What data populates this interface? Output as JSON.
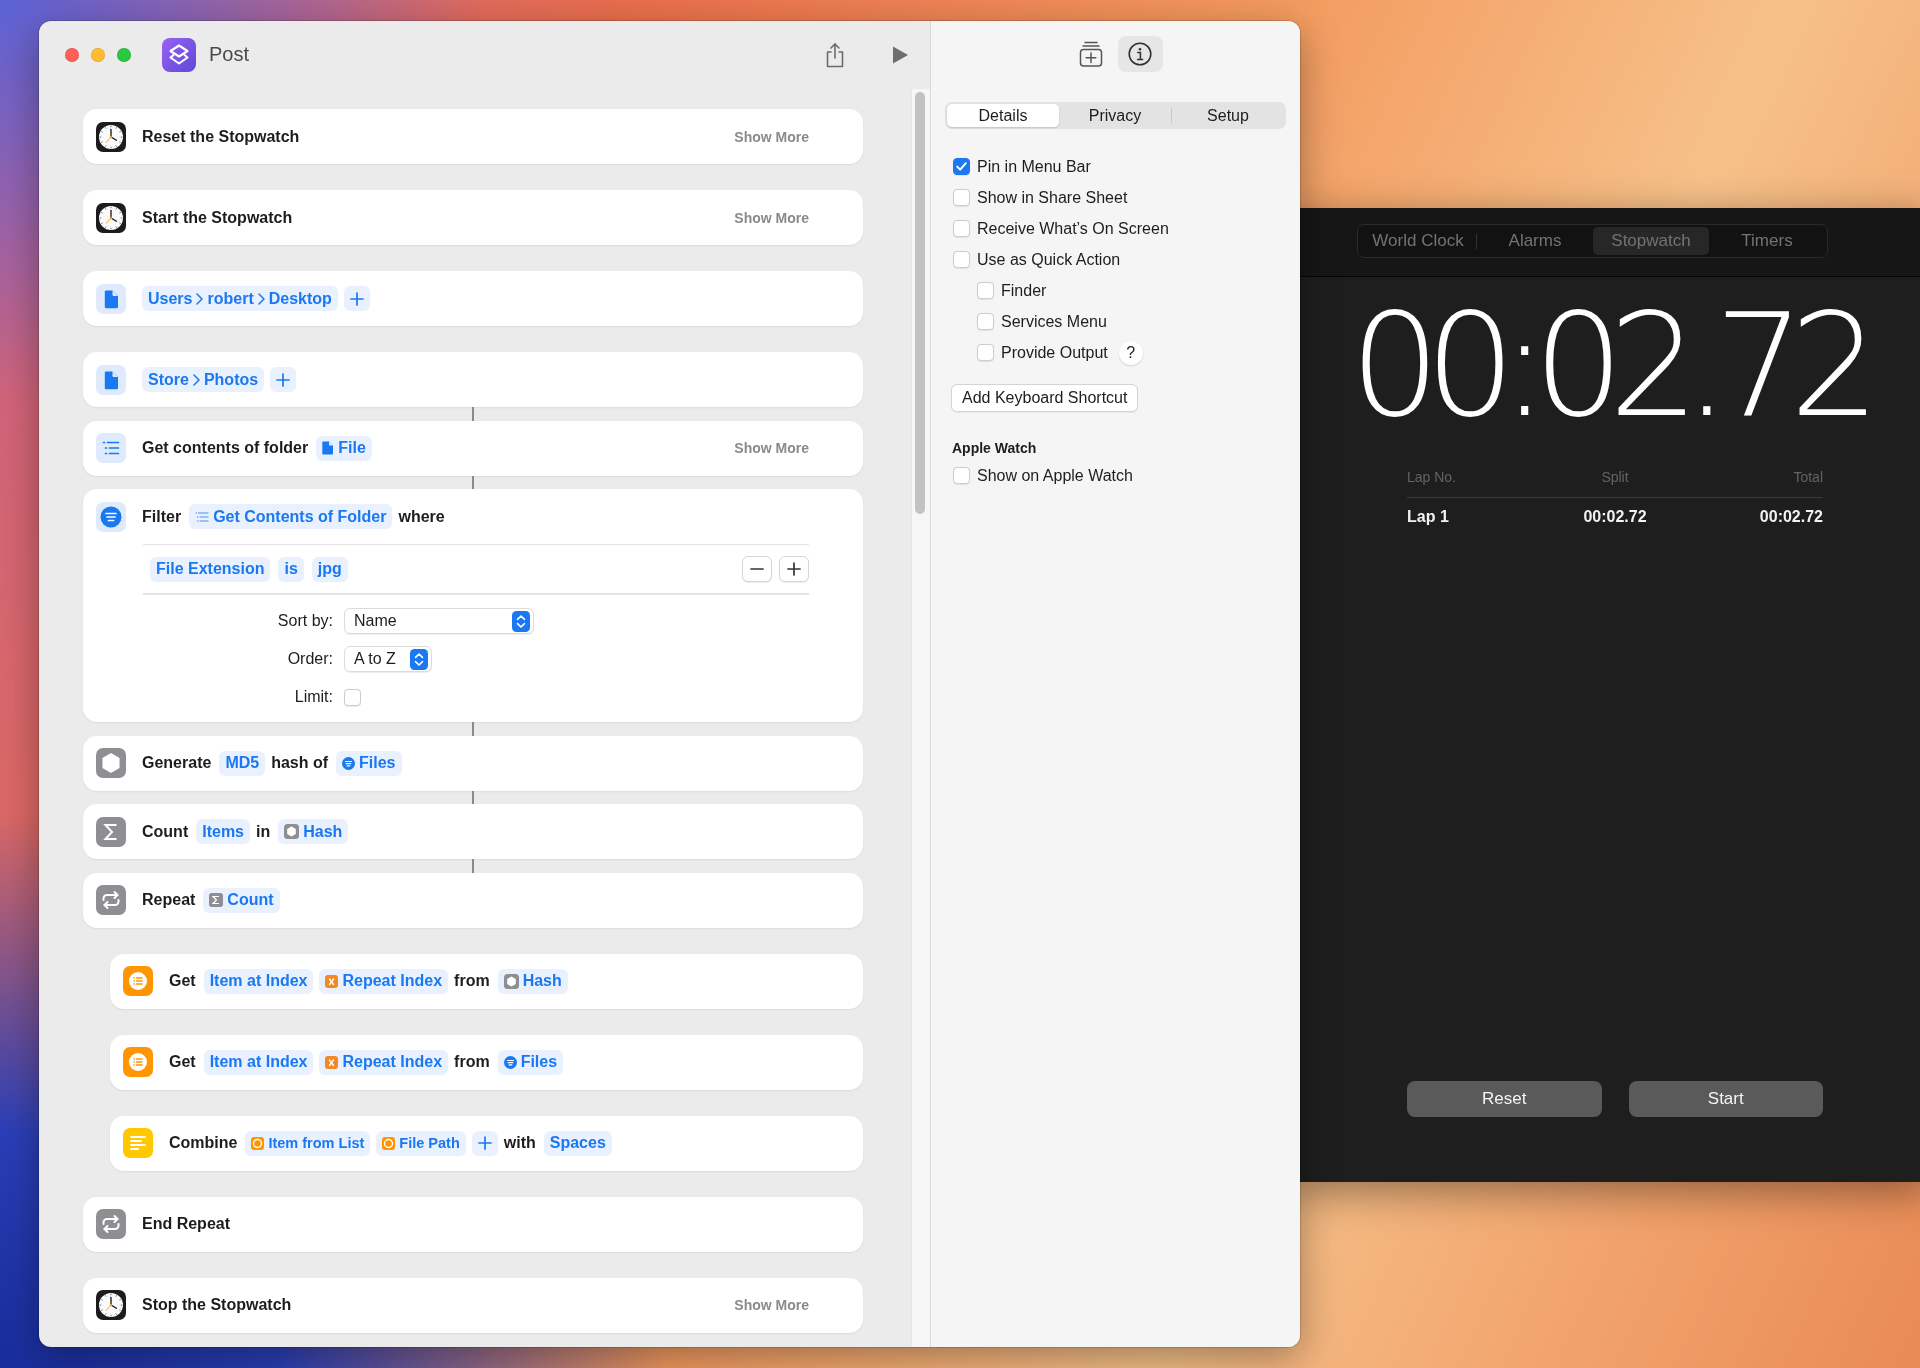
{
  "shortcuts_window": {
    "title": "Post",
    "actions": [
      {
        "kind": "stopwatch",
        "linked": false,
        "tokens": [
          {
            "kind": "label",
            "text": "Reset the Stopwatch"
          }
        ],
        "more": "Show More"
      },
      {
        "kind": "stopwatch",
        "linked": false,
        "tokens": [
          {
            "kind": "label",
            "text": "Start the Stopwatch"
          }
        ],
        "more": "Show More"
      },
      {
        "kind": "file",
        "linked": false,
        "tokens": [
          {
            "kind": "path",
            "segments": [
              "Users",
              "robert",
              "Desktop"
            ]
          },
          {
            "kind": "add"
          }
        ]
      },
      {
        "kind": "file",
        "linked": false,
        "tokens": [
          {
            "kind": "path",
            "segments": [
              "Store",
              "Photos"
            ]
          },
          {
            "kind": "add"
          }
        ]
      },
      {
        "kind": "folder",
        "linked": true,
        "tokens": [
          {
            "kind": "label",
            "text": "Get contents of folder"
          },
          {
            "kind": "file",
            "text": "File"
          }
        ],
        "more": "Show More"
      },
      {
        "kind": "filter",
        "linked": true,
        "tokens": [
          {
            "kind": "label",
            "text": "Filter"
          },
          {
            "kind": "list",
            "text": "Get Contents of Folder"
          },
          {
            "kind": "label",
            "text": "where"
          }
        ],
        "conditions": [
          [
            {
              "kind": "param",
              "text": "File Extension"
            },
            {
              "kind": "param",
              "text": "is"
            },
            {
              "kind": "param",
              "text": "jpg"
            }
          ]
        ],
        "settings": [
          {
            "kind": "popup",
            "label": "Sort by:",
            "value": "Name"
          },
          {
            "kind": "popup",
            "label": "Order:",
            "value": "A to Z"
          },
          {
            "kind": "checkbox",
            "label": "Limit:",
            "checked": false
          }
        ]
      },
      {
        "kind": "hash",
        "linked": true,
        "tokens": [
          {
            "kind": "label",
            "text": "Generate"
          },
          {
            "kind": "param",
            "text": "MD5"
          },
          {
            "kind": "label",
            "text": "hash of"
          },
          {
            "kind": "filter",
            "text": "Files"
          }
        ]
      },
      {
        "kind": "count",
        "linked": true,
        "tokens": [
          {
            "kind": "label",
            "text": "Count"
          },
          {
            "kind": "param",
            "text": "Items"
          },
          {
            "kind": "label",
            "text": "in"
          },
          {
            "kind": "hash",
            "text": "Hash"
          }
        ]
      },
      {
        "kind": "repeat",
        "linked": true,
        "tokens": [
          {
            "kind": "label",
            "text": "Repeat"
          },
          {
            "kind": "count",
            "text": "Count"
          }
        ],
        "children": [
          {
            "kind": "item",
            "linked": false,
            "tokens": [
              {
                "kind": "label",
                "text": "Get"
              },
              {
                "kind": "param",
                "text": "Item at Index"
              },
              {
                "kind": "index",
                "text": "Repeat Index"
              },
              {
                "kind": "label",
                "text": "from"
              },
              {
                "kind": "hash",
                "text": "Hash"
              }
            ]
          },
          {
            "kind": "item",
            "linked": false,
            "tokens": [
              {
                "kind": "label",
                "text": "Get"
              },
              {
                "kind": "param",
                "text": "Item at Index"
              },
              {
                "kind": "index",
                "text": "Repeat Index"
              },
              {
                "kind": "label",
                "text": "from"
              },
              {
                "kind": "filter",
                "text": "Files"
              }
            ]
          },
          {
            "kind": "text",
            "linked": false,
            "tokens": [
              {
                "kind": "label",
                "text": "Combine"
              },
              {
                "kind": "item",
                "text": "Item from List"
              },
              {
                "kind": "item",
                "text": "File Path"
              },
              {
                "kind": "add"
              },
              {
                "kind": "label",
                "text": "with"
              },
              {
                "kind": "param",
                "text": "Spaces"
              }
            ]
          }
        ]
      },
      {
        "kind": "repeat",
        "linked": false,
        "tokens": [
          {
            "kind": "label",
            "text": "End Repeat"
          }
        ]
      },
      {
        "kind": "stopwatch",
        "linked": false,
        "tokens": [
          {
            "kind": "label",
            "text": "Stop the Stopwatch"
          }
        ],
        "more": "Show More"
      }
    ],
    "inspector": {
      "toolbar": [
        {
          "kind": "library",
          "selected": false
        },
        {
          "kind": "info",
          "selected": true
        }
      ],
      "tabs": [
        {
          "label": "Details",
          "selected": true
        },
        {
          "label": "Privacy",
          "selected": false
        },
        {
          "label": "Setup",
          "selected": false
        }
      ],
      "options": [
        {
          "label": "Pin in Menu Bar",
          "checked": true
        },
        {
          "label": "Show in Share Sheet",
          "checked": false
        },
        {
          "label": "Receive What’s On Screen",
          "checked": false
        },
        {
          "label": "Use as Quick Action",
          "checked": false,
          "children": [
            {
              "label": "Finder",
              "checked": false
            },
            {
              "label": "Services Menu",
              "checked": false
            },
            {
              "label": "Provide Output",
              "checked": false,
              "help": "?"
            }
          ]
        }
      ],
      "shortcut_button": "Add Keyboard Shortcut",
      "watch": {
        "heading": "Apple Watch",
        "options": [
          {
            "label": "Show on Apple Watch",
            "checked": false
          }
        ]
      }
    }
  },
  "clock_window": {
    "tabs": [
      {
        "label": "World Clock",
        "selected": false
      },
      {
        "label": "Alarms",
        "selected": false
      },
      {
        "label": "Stopwatch",
        "selected": true
      },
      {
        "label": "Timers",
        "selected": false
      }
    ],
    "time": "00:02.72",
    "laps": {
      "columns": [
        "Lap No.",
        "Split",
        "Total"
      ],
      "rows": [
        [
          "Lap 1",
          "00:02.72",
          "00:02.72"
        ]
      ]
    },
    "buttons": [
      "Reset",
      "Start"
    ]
  }
}
